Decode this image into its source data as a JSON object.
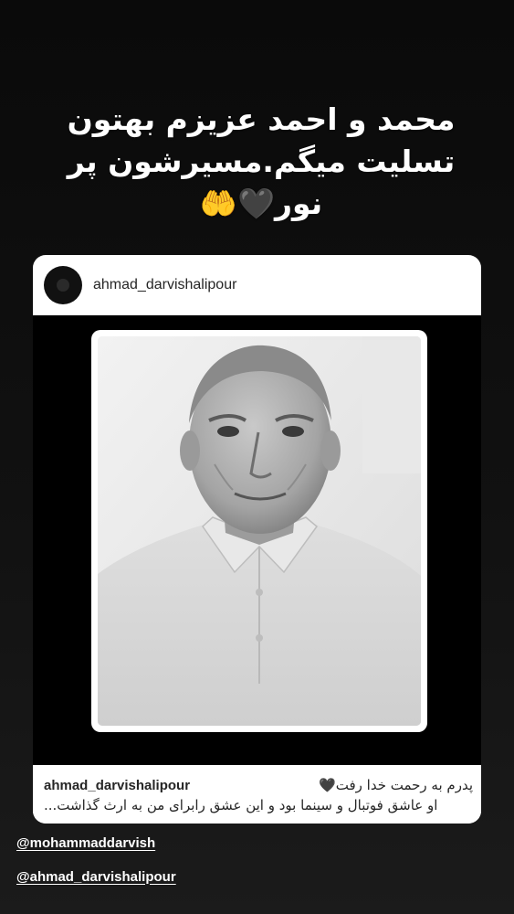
{
  "overlay": {
    "line1": "محمد و احمد عزیزم بهتون",
    "line2": "تسلیت میگم.مسیرشون پر",
    "line3": "نور",
    "emoji": "🖤🤲"
  },
  "post": {
    "username": "ahmad_darvishalipour",
    "caption_user": "ahmad_darvishalipour",
    "caption_line1": "پدرم به رحمت خدا رفت🖤",
    "caption_line2": "او عاشق فوتبال و سینما بود و این عشق رابرای من به ارث گذاشت..."
  },
  "mentions": [
    "@mohammaddarvish",
    "@ahmad_darvishalipour"
  ],
  "icons": [
    "avatar",
    "black-heart-icon",
    "raised-hands-icon"
  ],
  "colors": {
    "background": "#0b0b0b",
    "card": "#ffffff",
    "text_dark": "#262626",
    "text_light": "#ffffff"
  }
}
